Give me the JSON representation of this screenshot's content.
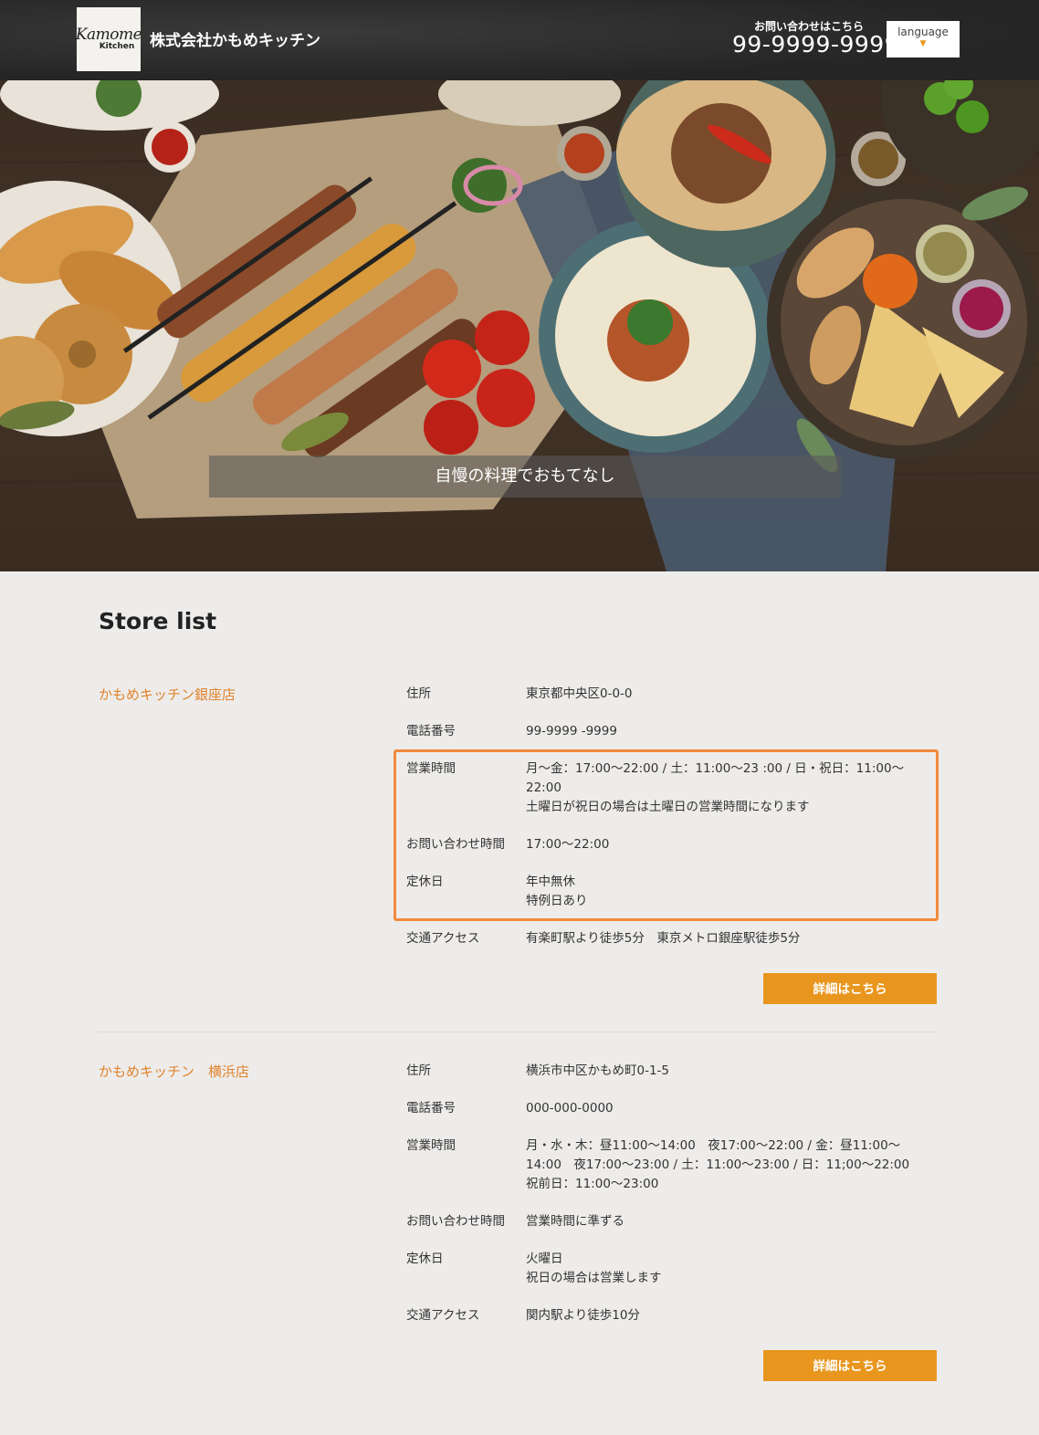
{
  "header": {
    "logo_script": "Kamome",
    "logo_sub": "Kitchen",
    "company_name": "株式会社かもめキッチン",
    "contact_label": "お問い合わせはこちら",
    "phone": "99-9999-9999",
    "language_label": "language",
    "language_arrow": "▼"
  },
  "hero": {
    "caption": "自慢の料理でおもてなし"
  },
  "main": {
    "title": "Store list",
    "detail_label": "詳細はこちら",
    "stores": [
      {
        "name": "かもめキッチン銀座店",
        "rows": [
          {
            "label": "住所",
            "lines": [
              "東京都中央区0-0-0"
            ]
          },
          {
            "label": "電話番号",
            "lines": [
              "99-9999 -9999"
            ]
          },
          {
            "label": "営業時間",
            "lines": [
              "月～金：17:00～22:00 / 土：11:00～23 :00 / 日・祝日：11:00～",
              "22:00",
              "土曜日が祝日の場合は土曜日の営業時間になります"
            ]
          },
          {
            "label": "お問い合わせ時間",
            "lines": [
              "17:00～22:00"
            ]
          },
          {
            "label": "定休日",
            "lines": [
              "年中無休",
              "特例日あり"
            ]
          },
          {
            "label": "交通アクセス",
            "lines": [
              "有楽町駅より徒歩5分　東京メトロ銀座駅徒歩5分"
            ]
          }
        ]
      },
      {
        "name": "かもめキッチン　横浜店",
        "rows": [
          {
            "label": "住所",
            "lines": [
              "横浜市中区かもめ町0-1-5"
            ]
          },
          {
            "label": "電話番号",
            "lines": [
              "000-000-0000"
            ]
          },
          {
            "label": "営業時間",
            "lines": [
              "月・水・木：昼11:00～14:00　夜17:00～22:00 / 金：昼11:00～",
              "14:00　夜17:00～23:00 / 土：11:00～23:00 / 日：11;00～22:00",
              "祝前日：11:00～23:00"
            ]
          },
          {
            "label": "お問い合わせ時間",
            "lines": [
              "営業時間に準ずる"
            ]
          },
          {
            "label": "定休日",
            "lines": [
              "火曜日",
              "祝日の場合は営業します"
            ]
          },
          {
            "label": "交通アクセス",
            "lines": [
              "関内駅より徒歩10分"
            ]
          }
        ]
      }
    ]
  },
  "colors": {
    "accent": "#e8961e",
    "store_name": "#e0832d",
    "highlight": "#f08a3c",
    "header_bg": "#2b2b2b",
    "page_bg": "#eeecea"
  }
}
